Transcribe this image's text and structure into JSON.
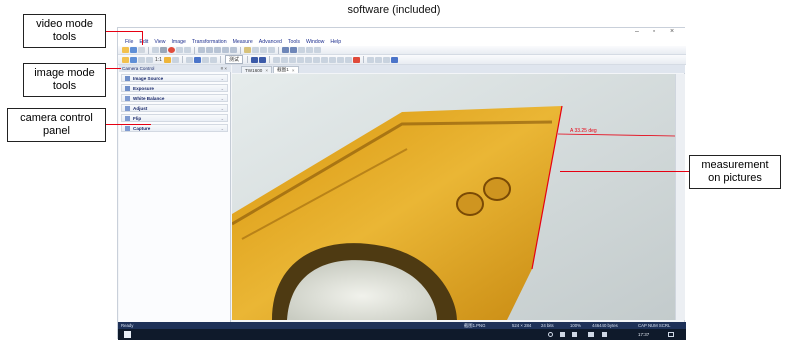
{
  "page_title": "software (included)",
  "callouts": {
    "video_mode": {
      "line1": "video mode",
      "line2": "tools"
    },
    "image_mode": {
      "line1": "image mode",
      "line2": "tools"
    },
    "camera_control": {
      "line1": "camera control",
      "line2": "panel"
    },
    "measurement": {
      "line1": "measurement",
      "line2": "on pictures"
    }
  },
  "menu": [
    "File",
    "Edit",
    "View",
    "Image",
    "Transformation",
    "Measure",
    "Advanced",
    "Tools",
    "Window",
    "Help"
  ],
  "toolbar2": {
    "zoom_text": "1:1",
    "text_tool": "测试"
  },
  "panel": {
    "title": "Camera Control",
    "title_buttons": "# ×",
    "items": [
      {
        "label": "Image Source"
      },
      {
        "label": "Exposure"
      },
      {
        "label": "White Balance"
      },
      {
        "label": "Adjust"
      },
      {
        "label": "Flip"
      },
      {
        "label": "Capture"
      }
    ]
  },
  "tabs": [
    {
      "label": "TW1600"
    },
    {
      "label": "截图1"
    }
  ],
  "tab_close": "×",
  "measurement_label": "A 33.25 deg",
  "statusbar": {
    "ready": "Ready",
    "file": "截图1.PNG",
    "dims": "524 × 284",
    "depth": "24 bits",
    "zoom": "100%",
    "size": "446440 bytes",
    "caps": "CAP NUM SCRL"
  },
  "taskbar": {
    "time": "17:37"
  },
  "colors": {
    "accent": "#e60012",
    "statusbar": "#1e3158",
    "panel_text": "#1b2a6b"
  }
}
